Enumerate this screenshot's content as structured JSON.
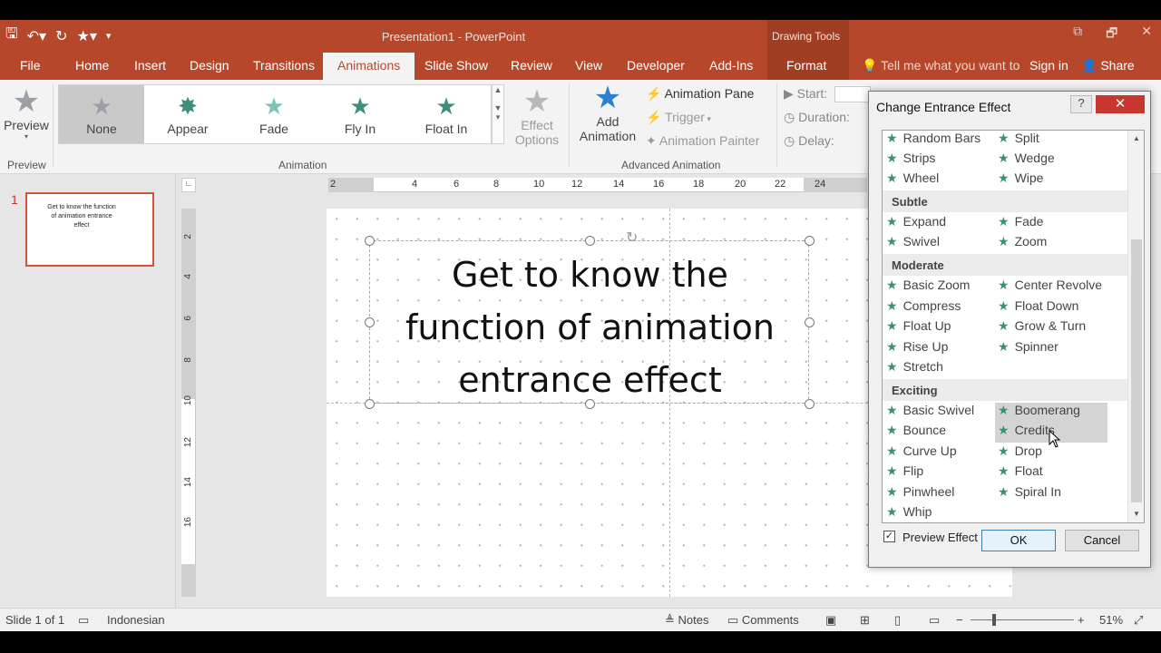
{
  "window": {
    "title": "Presentation1 - PowerPoint",
    "context_tab_group": "Drawing Tools",
    "controls": [
      "⧉",
      "🗗",
      "✕"
    ]
  },
  "quick_access": {
    "icons": [
      "save-icon",
      "undo-icon",
      "redo-icon",
      "star-icon",
      "customize-icon"
    ]
  },
  "tabs": [
    {
      "label": "File"
    },
    {
      "label": "Home"
    },
    {
      "label": "Insert"
    },
    {
      "label": "Design"
    },
    {
      "label": "Transitions"
    },
    {
      "label": "Animations",
      "active": true
    },
    {
      "label": "Slide Show"
    },
    {
      "label": "Review"
    },
    {
      "label": "View"
    },
    {
      "label": "Developer"
    },
    {
      "label": "Add-Ins"
    },
    {
      "label": "Format"
    }
  ],
  "tellme": "Tell me what you want to",
  "signin": "Sign in",
  "share": "Share",
  "ribbon": {
    "preview": {
      "label": "Preview",
      "group": "Preview"
    },
    "animation_gallery": {
      "group": "Animation",
      "items": [
        {
          "label": "None",
          "selected": true,
          "color": "#9aa0a6"
        },
        {
          "label": "Appear",
          "color": "#3e8e7e"
        },
        {
          "label": "Fade",
          "color": "#7cc3b6"
        },
        {
          "label": "Fly In",
          "color": "#3e8e7e"
        },
        {
          "label": "Float In",
          "color": "#3e8e7e"
        }
      ]
    },
    "effect_options": {
      "line1": "Effect",
      "line2": "Options"
    },
    "advanced": {
      "group": "Advanced Animation",
      "add_animation_1": "Add",
      "add_animation_2": "Animation",
      "animation_pane": "Animation Pane",
      "trigger": "Trigger",
      "animation_painter": "Animation Painter"
    },
    "timing": {
      "start": "Start:",
      "duration": "Duration:",
      "delay": "Delay:"
    }
  },
  "thumbnail": {
    "number": "1",
    "text": "Get to know the function of animation entrance effect"
  },
  "ruler_h": [
    "2",
    "2",
    "4",
    "6",
    "8",
    "10",
    "12",
    "14",
    "16",
    "18",
    "20",
    "22",
    "24"
  ],
  "ruler_v": [
    "2",
    "2",
    "4",
    "6",
    "8",
    "10",
    "12",
    "14",
    "16"
  ],
  "slide": {
    "line1": "Get to know the",
    "line2": "function of animation",
    "line3": "entrance effect"
  },
  "dialog": {
    "title": "Change Entrance Effect",
    "help": "?",
    "close": "✕",
    "top_rows": [
      [
        "Random Bars",
        "Split"
      ],
      [
        "Strips",
        "Wedge"
      ],
      [
        "Wheel",
        "Wipe"
      ]
    ],
    "sections": [
      {
        "title": "Subtle",
        "rows": [
          [
            "Expand",
            "Fade"
          ],
          [
            "Swivel",
            "Zoom"
          ]
        ]
      },
      {
        "title": "Moderate",
        "rows": [
          [
            "Basic Zoom",
            "Center Revolve"
          ],
          [
            "Compress",
            "Float Down"
          ],
          [
            "Float Up",
            "Grow & Turn"
          ],
          [
            "Rise Up",
            "Spinner"
          ],
          [
            "Stretch",
            ""
          ]
        ]
      },
      {
        "title": "Exciting",
        "rows": [
          [
            "Basic Swivel",
            "Boomerang"
          ],
          [
            "Bounce",
            "Credits"
          ],
          [
            "Curve Up",
            "Drop"
          ],
          [
            "Flip",
            "Float"
          ],
          [
            "Pinwheel",
            "Spiral In"
          ],
          [
            "Whip",
            ""
          ]
        ]
      }
    ],
    "preview_effect": "Preview Effect",
    "preview_checked": "✓",
    "ok": "OK",
    "cancel": "Cancel"
  },
  "status": {
    "slide_of": "Slide 1 of 1",
    "language": "Indonesian",
    "notes": "Notes",
    "comments": "Comments",
    "zoom": "51%",
    "minus": "−",
    "plus": "+"
  },
  "colors": {
    "accent": "#b7472a",
    "effect_star": "#3e8e7e"
  }
}
